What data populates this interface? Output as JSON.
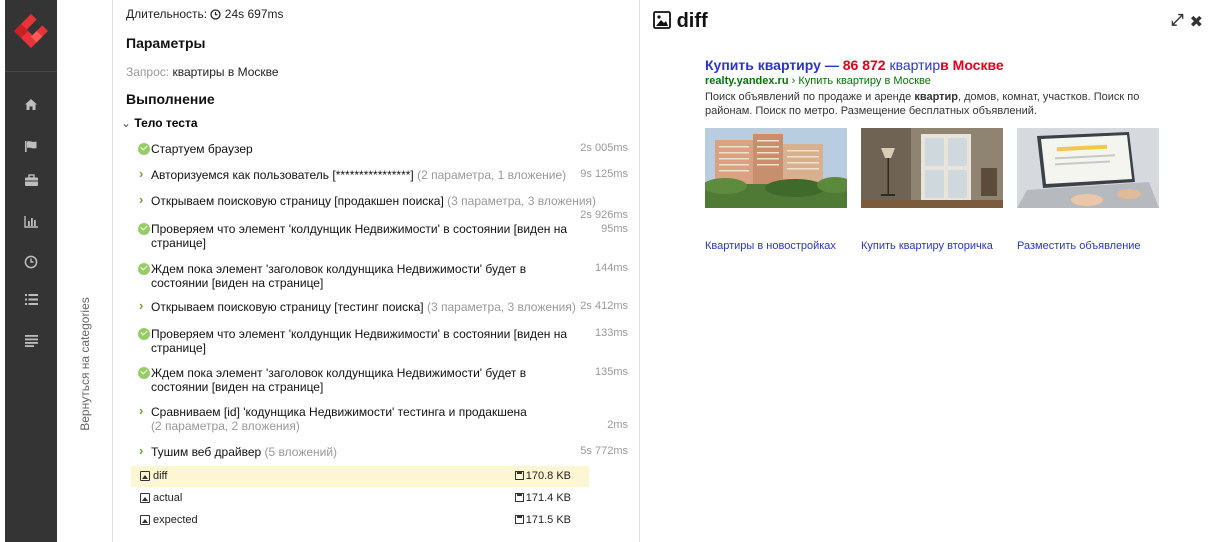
{
  "nav": {
    "items": [
      "home-icon",
      "flag-icon",
      "briefcase-icon",
      "bar-chart-icon",
      "clock-icon",
      "list-icon",
      "menu-lines-icon"
    ]
  },
  "back": {
    "label": "Вернуться на categories"
  },
  "result": {
    "duration_label": "Длительность:",
    "duration_value": "24s 697ms",
    "params_title": "Параметры",
    "param_name": "Запрос:",
    "param_value": "квартиры в Москве",
    "execution_title": "Выполнение",
    "body_label": "Тело теста",
    "steps": [
      {
        "status": "passed",
        "text": "Стартуем браузер",
        "meta": "",
        "time": "2s 005ms"
      },
      {
        "status": "expand",
        "text": "Авторизуемся как пользователь [****************]",
        "meta": "(2 параметра, 1 вложение)",
        "time": "9s 125ms"
      },
      {
        "status": "expand",
        "text": "Открываем поисковую страницу [продакшен поиска]",
        "meta": "(3 параметра, 3 вложения)",
        "time": "2s 926ms"
      },
      {
        "status": "passed",
        "text": "Проверяем что элемент 'колдунщик Недвижимости' в состоянии [виден на странице]",
        "meta": "",
        "time": "95ms"
      },
      {
        "status": "passed",
        "text": "Ждем пока элемент 'заголовок колдунщика Недвижимости' будет в состоянии [виден на странице]",
        "meta": "",
        "time": "144ms"
      },
      {
        "status": "expand",
        "text": "Открываем поисковую страницу [тестинг поиска]",
        "meta": "(3 параметра, 3 вложения)",
        "time": "2s 412ms"
      },
      {
        "status": "passed",
        "text": "Проверяем что элемент 'колдунщик Недвижимости' в состоянии [виден на странице]",
        "meta": "",
        "time": "133ms"
      },
      {
        "status": "passed",
        "text": "Ждем пока элемент 'заголовок колдунщика Недвижимости' будет в состоянии [виден на странице]",
        "meta": "",
        "time": "135ms"
      },
      {
        "status": "expand",
        "text": "Сравниваем [id] 'кодунщика Недвижимости' тестинга и продакшена",
        "meta": "(2 параметра, 2 вложения)",
        "time": "2ms"
      },
      {
        "status": "expand",
        "text": "Тушим веб драйвер",
        "meta": "(5 вложений)",
        "time": "5s 772ms"
      }
    ],
    "attachments": [
      {
        "name": "diff",
        "size": "170.8 KB",
        "selected": true
      },
      {
        "name": "actual",
        "size": "171.4 KB",
        "selected": false
      },
      {
        "name": "expected",
        "size": "171.5 KB",
        "selected": false
      }
    ]
  },
  "diff": {
    "title": "diff",
    "serp": {
      "link_main": "Купить квартиру —",
      "link_num": "86 872",
      "link_word": "квартир",
      "link_tail": "в Москве",
      "url_domain": "realty.yandex.ru",
      "url_path": "› Купить квартиру в Москве",
      "desc_1": "Поиск объявлений по продаже и аренде ",
      "desc_bold": "квартир",
      "desc_2": ", домов, комнат, участков. Поиск по районам. Поиск по метро. Размещение бесплатных объявлений."
    },
    "thumbs": [
      {
        "caption": "Квартиры в новостройках"
      },
      {
        "caption": "Купить квартиру вторичка"
      },
      {
        "caption": "Разместить объявление"
      }
    ]
  }
}
